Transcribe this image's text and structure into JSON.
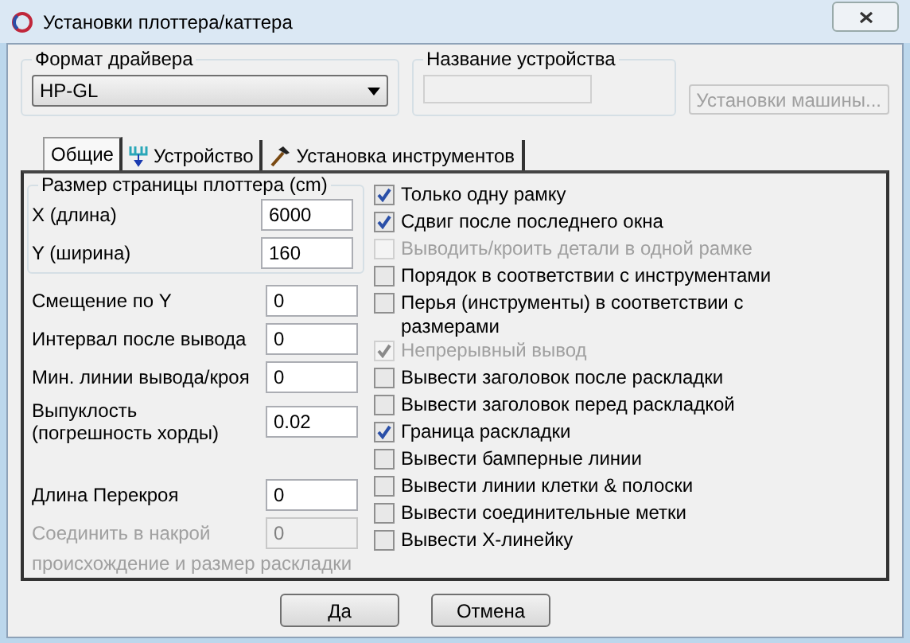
{
  "window": {
    "title": "Установки плоттера/каттера"
  },
  "driver_format": {
    "label": "Формат драйвера",
    "value": "HP-GL"
  },
  "device_name": {
    "label": "Название устройства",
    "disabled": true
  },
  "machine_settings_button": {
    "label": "Установки машины...",
    "disabled": true
  },
  "tabs": [
    {
      "label": "Общие",
      "selected": true,
      "kind": "plain"
    },
    {
      "label": "Устройство",
      "selected": false,
      "kind": "device"
    },
    {
      "label": "Установка инструментов",
      "selected": false,
      "kind": "tools"
    }
  ],
  "page_size": {
    "label": "Размер страницы плоттера (cm)",
    "fields": [
      {
        "label": "X (длина)",
        "value": "6000",
        "disabled": false
      },
      {
        "label": "Y (ширина)",
        "value": "160",
        "disabled": false
      }
    ]
  },
  "fields": [
    {
      "label": "Смещение по Y",
      "value": "0",
      "disabled": false
    },
    {
      "label": "Интервал после вывода",
      "value": "0",
      "disabled": false
    },
    {
      "label": "Мин. линии вывода/кроя",
      "value": "0",
      "disabled": false
    },
    {
      "label": "Выпуклость (погрешность хорды)",
      "value": "0.02",
      "disabled": false
    }
  ],
  "fields_lower": [
    {
      "label": "Длина Перекроя",
      "value": "0",
      "disabled": false
    },
    {
      "label": "Соединить в накрой",
      "value": "0",
      "disabled": true
    }
  ],
  "note": {
    "text": "происхождение и размер раскладки",
    "disabled": true
  },
  "options": [
    {
      "label": "Только одну рамку",
      "checked": true,
      "disabled": false
    },
    {
      "label": "Сдвиг после последнего окна",
      "checked": true,
      "disabled": false
    },
    {
      "label": "Выводить/кроить детали в одной рамке",
      "checked": false,
      "disabled": true
    },
    {
      "label": "Порядок в соответствии с инструментами",
      "checked": false,
      "disabled": false
    },
    {
      "label": "Перья (инструменты) в соответствии с размерами",
      "checked": false,
      "disabled": false
    },
    {
      "label": "Непрерывный вывод",
      "checked": true,
      "disabled": true
    },
    {
      "label": "Вывести заголовок после раскладки",
      "checked": false,
      "disabled": false
    },
    {
      "label": "Вывести заголовок перед раскладкой",
      "checked": false,
      "disabled": false
    },
    {
      "label": "Граница раскладки",
      "checked": true,
      "disabled": false
    },
    {
      "label": "Вывести бамперные линии",
      "checked": false,
      "disabled": false
    },
    {
      "label": "Вывести линии клетки & полоски",
      "checked": false,
      "disabled": false
    },
    {
      "label": "Вывести соединительные метки",
      "checked": false,
      "disabled": false
    },
    {
      "label": "Вывести X-линейку",
      "checked": false,
      "disabled": false
    }
  ],
  "buttons": [
    "Да",
    "Отмена"
  ]
}
